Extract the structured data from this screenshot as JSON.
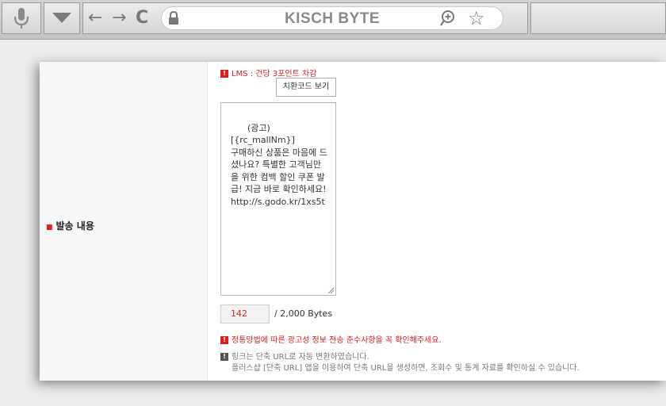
{
  "browser": {
    "title": "KISCH BYTE",
    "icons": {
      "mic": "microphone-icon",
      "dropdown": "triangle-down-icon",
      "back": "back-arrow-icon",
      "forward": "forward-arrow-icon",
      "reload": "reload-icon",
      "lock": "lock-icon",
      "zoom": "zoom-in-icon",
      "bookmark": "star-icon"
    },
    "glyphs": {
      "back": "←",
      "forward": "→",
      "reload": "C",
      "star": "☆"
    }
  },
  "form": {
    "field_label": "발송 내용",
    "lms_notice": "LMS : 건당 3포인트 차감",
    "notice_mark": "!",
    "code_button": "치환코드 보기",
    "message": "(광고)\n[{rc_mallNm}]\n구매하신 상품은 마음에 드셨나요? 특별한 고객님만을 위한 컴백 할인 쿠폰 발급! 지금 바로 확인하세요!\nhttp://s.godo.kr/1xs5t",
    "byte_count": "142",
    "byte_limit": "/ 2,000 Bytes",
    "law_notice": "정통망법에 따른 광고성 정보 전송 준수사항을 꼭 확인해주세요.",
    "info_line1": "링크는 단축 URL로 자동 변환하였습니다.",
    "info_line2": "플러스샵 [단축 URL] 앱을 이용하여 단축 URL을 생성하면, 조회수 및 통계 자료를 확인하실 수 있습니다."
  },
  "colors": {
    "accent_red": "#d9201f",
    "chrome_gray": "#c8c8c8"
  }
}
